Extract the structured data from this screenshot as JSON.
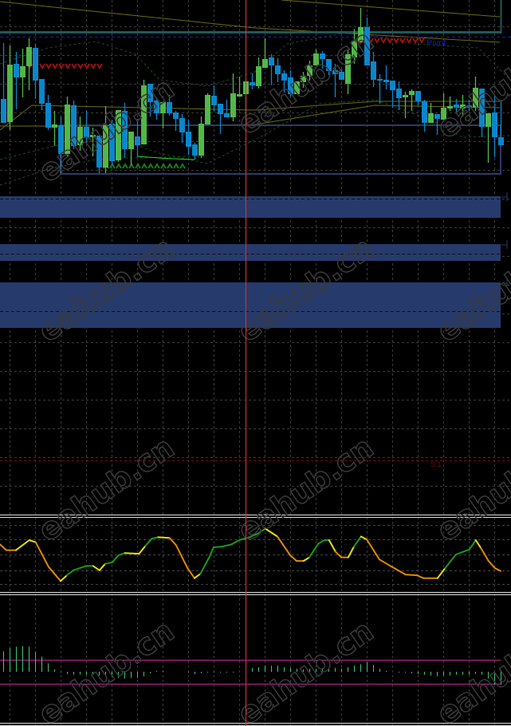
{
  "watermark": "eahub.cn",
  "colors": {
    "bull": "#52b848",
    "bear": "#0b86cc",
    "band": "#263a6c",
    "grid": "#3a3a3a",
    "crosshair": "#e0303c",
    "olive": "#6b6b10",
    "teal": "#1f5a58",
    "pivot_text": "#1a1aa8",
    "arrow_red": "#a01010",
    "arrow_green": "#1a7a1a",
    "osc_up": "#1a9a1a",
    "osc_down": "#e08a00",
    "osc_turn": "#e8e000",
    "hist": "#3ec878",
    "level": "#c02890",
    "s1": "#7a0c0c"
  },
  "labels": {
    "pivot": "Pivot",
    "s1": "S 1"
  },
  "chart_data": [
    {
      "type": "candlestick",
      "title": "",
      "ohlc_fields": [
        "open",
        "high",
        "low",
        "close"
      ],
      "ylim": [
        0,
        250
      ],
      "grid": true,
      "candles": [
        [
          126,
          196,
          96,
          96
        ],
        [
          97,
          193,
          87,
          169
        ],
        [
          170,
          185,
          113,
          153
        ],
        [
          153,
          189,
          128,
          167
        ],
        [
          167,
          202,
          137,
          191
        ],
        [
          190,
          195,
          126,
          149
        ],
        [
          151,
          151,
          112,
          120
        ],
        [
          121,
          131,
          87,
          90
        ],
        [
          90,
          111,
          67,
          94
        ],
        [
          93,
          104,
          31,
          57
        ],
        [
          57,
          129,
          53,
          119
        ],
        [
          118,
          124,
          63,
          67
        ],
        [
          68,
          104,
          61,
          91
        ],
        [
          91,
          112,
          70,
          78
        ],
        [
          78,
          90,
          54,
          81
        ],
        [
          80,
          80,
          33,
          40
        ],
        [
          40,
          117,
          33,
          93
        ],
        [
          95,
          100,
          43,
          48
        ],
        [
          49,
          112,
          47,
          112
        ],
        [
          111,
          121,
          52,
          63
        ],
        [
          63,
          85,
          43,
          85
        ],
        [
          79,
          101,
          53,
          68
        ],
        [
          69,
          150,
          69,
          143
        ],
        [
          145,
          145,
          104,
          122
        ],
        [
          124,
          128,
          100,
          108
        ],
        [
          108,
          122,
          89,
          122
        ],
        [
          122,
          131,
          105,
          108
        ],
        [
          109,
          111,
          86,
          101
        ],
        [
          102,
          107,
          71,
          84
        ],
        [
          85,
          100,
          56,
          66
        ],
        [
          69,
          71,
          50,
          55
        ],
        [
          55,
          104,
          52,
          95
        ],
        [
          94,
          133,
          94,
          131
        ],
        [
          130,
          143,
          111,
          118
        ],
        [
          120,
          120,
          82,
          107
        ],
        [
          108,
          125,
          103,
          103
        ],
        [
          103,
          158,
          98,
          133
        ],
        [
          129,
          154,
          129,
          132
        ],
        [
          132,
          150,
          99,
          148
        ],
        [
          147,
          158,
          138,
          143
        ],
        [
          142,
          178,
          139,
          167
        ],
        [
          165,
          202,
          165,
          176
        ],
        [
          178,
          182,
          143,
          168
        ],
        [
          168,
          177,
          147,
          157
        ],
        [
          158,
          162,
          134,
          149
        ],
        [
          153,
          162,
          129,
          132
        ],
        [
          132,
          148,
          132,
          148
        ],
        [
          147,
          160,
          140,
          155
        ],
        [
          155,
          174,
          149,
          168
        ],
        [
          168,
          188,
          168,
          183
        ],
        [
          183,
          186,
          164,
          176
        ],
        [
          176,
          176,
          156,
          161
        ],
        [
          162,
          170,
          128,
          157
        ],
        [
          160,
          163,
          150,
          150
        ],
        [
          145,
          187,
          132,
          182
        ],
        [
          178,
          214,
          170,
          199
        ],
        [
          197,
          240,
          197,
          216
        ],
        [
          216,
          228,
          168,
          168
        ],
        [
          173,
          185,
          141,
          150
        ],
        [
          151,
          157,
          120,
          150
        ],
        [
          150,
          168,
          138,
          147
        ],
        [
          149,
          149,
          115,
          137
        ],
        [
          139,
          148,
          112,
          127
        ],
        [
          128,
          135,
          102,
          131
        ],
        [
          131,
          138,
          111,
          136
        ],
        [
          136,
          136,
          118,
          123
        ],
        [
          123,
          125,
          85,
          96
        ],
        [
          96,
          121,
          96,
          108
        ],
        [
          107,
          107,
          81,
          101
        ],
        [
          100,
          133,
          100,
          115
        ],
        [
          114,
          129,
          111,
          117
        ],
        [
          119,
          126,
          107,
          115
        ],
        [
          114,
          131,
          104,
          119
        ],
        [
          118,
          125,
          111,
          115
        ],
        [
          115,
          154,
          111,
          140
        ],
        [
          139,
          139,
          78,
          91
        ],
        [
          91,
          108,
          46,
          108
        ],
        [
          109,
          130,
          53,
          78
        ],
        [
          78,
          124,
          68,
          68
        ]
      ]
    },
    {
      "type": "line",
      "title": "",
      "ylim": [
        0,
        100
      ],
      "grid": true,
      "x": [
        0,
        1,
        2.5,
        4.6,
        5.6,
        7.6,
        9.5,
        10.5,
        11.5,
        13.5,
        14.6,
        15.6,
        16.5,
        17.6,
        18.6,
        19.6,
        21.8,
        22.8,
        23.8,
        24.8,
        26.6,
        27.6,
        29.4,
        30.5,
        31.4,
        32.8,
        33.5,
        34.8,
        36.3,
        37.5,
        39.1,
        40.4,
        41.6,
        43.5,
        45.5,
        46.5,
        47.6,
        48.5,
        49.9,
        50.9,
        51.6,
        52.6,
        53.5,
        54.6,
        55.5,
        56.6,
        57.5,
        59.5,
        61.4,
        63.6,
        65.4,
        66.4,
        68.6,
        69.8,
        71.5,
        73.6,
        74.6,
        75.4,
        76.6,
        77.6,
        78.5
      ],
      "values": [
        64,
        56,
        56,
        70,
        67,
        33,
        13,
        21,
        28,
        34,
        34,
        28,
        37,
        39,
        49,
        52,
        51,
        62,
        72,
        74,
        73,
        63,
        31,
        17,
        23,
        46,
        60,
        61,
        64,
        70,
        74,
        79,
        86,
        75,
        49,
        41,
        41,
        46,
        65,
        70,
        70,
        54,
        46,
        46,
        61,
        75,
        71,
        43,
        33,
        22,
        21,
        17,
        17,
        31,
        50,
        57,
        70,
        59,
        41,
        31,
        27
      ]
    },
    {
      "type": "bar",
      "title": "",
      "ylim": [
        -20,
        40
      ],
      "levels": [
        5,
        -5
      ],
      "values": [
        27,
        31,
        33,
        34,
        33,
        26,
        20,
        11,
        3,
        -1,
        -3,
        -4,
        -4,
        -4,
        -4,
        -5,
        -5,
        -7,
        -8,
        -9,
        -8,
        -8,
        -6,
        -2,
        1,
        1,
        0,
        0,
        0,
        -1,
        -3,
        -2,
        -1,
        -1,
        -1,
        -1,
        -1,
        0,
        -1,
        5,
        6,
        8,
        8,
        8,
        6,
        5,
        4,
        3,
        4,
        4,
        5,
        5,
        5,
        4,
        6,
        8,
        10,
        13,
        9,
        4,
        1,
        0,
        -1,
        -1,
        -2,
        -3,
        -4,
        -5,
        -6,
        -5,
        -5,
        -4,
        -4,
        -4,
        -3,
        -4,
        -9,
        -17,
        -17
      ]
    }
  ]
}
